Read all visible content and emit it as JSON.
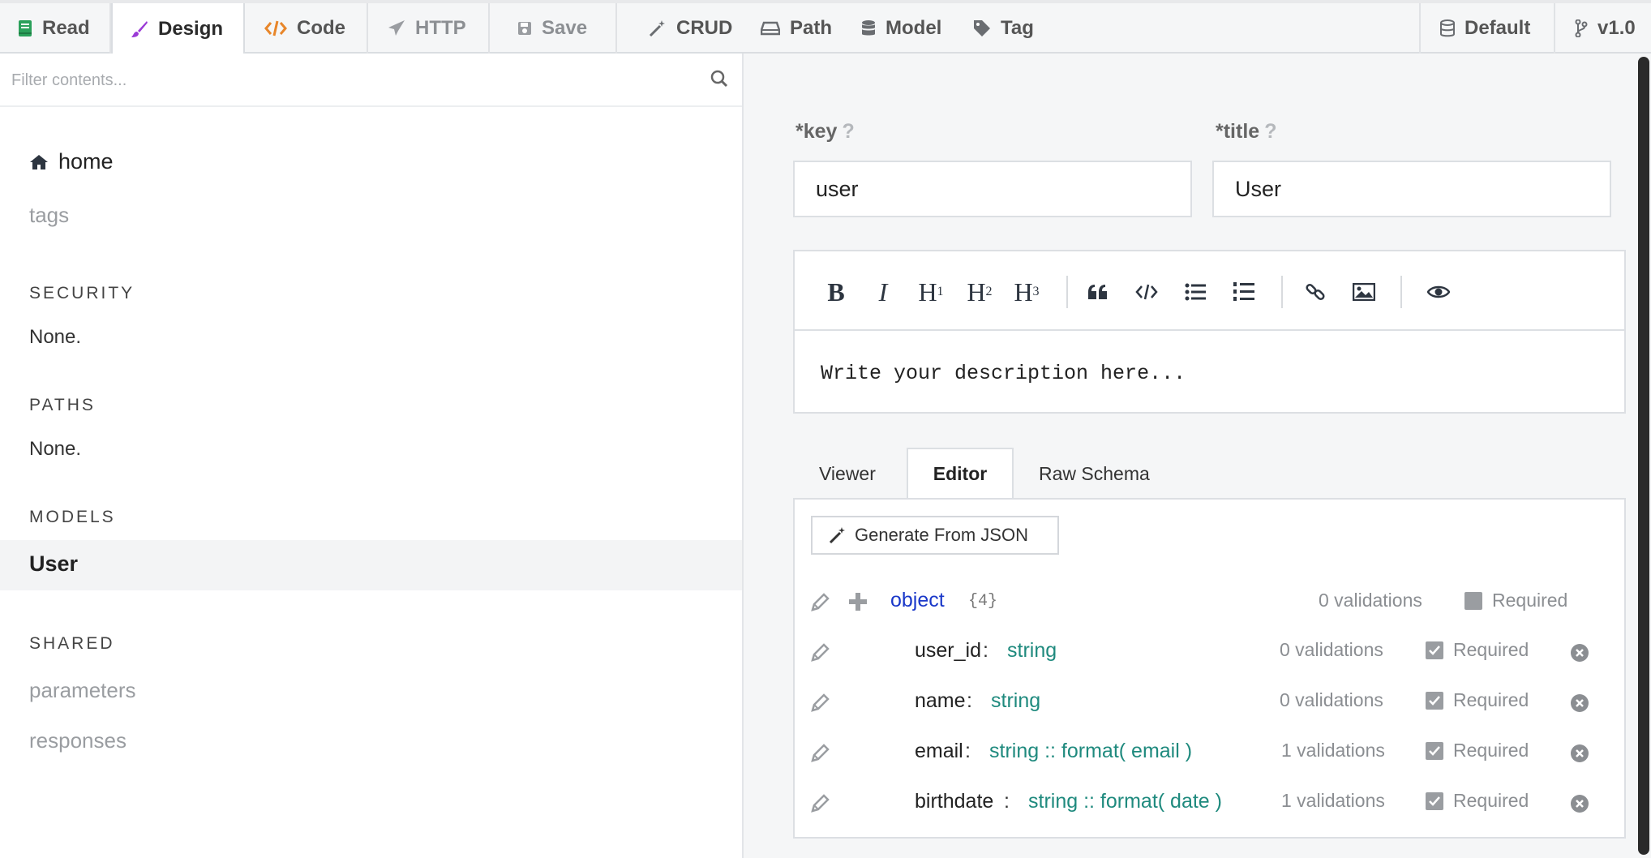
{
  "toolbar": {
    "tabs": [
      {
        "label": "Read",
        "icon": "book-icon",
        "color": "#2aa05a"
      },
      {
        "label": "Design",
        "icon": "paintbrush-icon",
        "color": "#9b3bd6"
      },
      {
        "label": "Code",
        "icon": "code-icon",
        "color": "#e8862a"
      },
      {
        "label": "HTTP",
        "icon": "paper-plane-icon"
      },
      {
        "label": "Save",
        "icon": "floppy-icon"
      },
      {
        "label": "CRUD",
        "icon": "magic-wand-icon"
      },
      {
        "label": "Path",
        "icon": "drive-icon"
      },
      {
        "label": "Model",
        "icon": "database-icon"
      },
      {
        "label": "Tag",
        "icon": "tag-icon"
      }
    ],
    "right": [
      {
        "label": "Default",
        "icon": "database-icon"
      },
      {
        "label": "v1.0",
        "icon": "branch-icon"
      }
    ]
  },
  "sidebar": {
    "filter_placeholder": "Filter contents...",
    "home": "home",
    "tags": "tags",
    "security_heading": "SECURITY",
    "security_value": "None.",
    "paths_heading": "PATHS",
    "paths_value": "None.",
    "models_heading": "MODELS",
    "selected_model": "User",
    "shared_heading": "SHARED",
    "shared_items": [
      "parameters",
      "responses"
    ]
  },
  "form": {
    "key_label": "*key",
    "key_help": "?",
    "key_value": "user",
    "title_label": "*title",
    "title_help": "?",
    "title_value": "User",
    "description_placeholder": "Write your description here...",
    "md_buttons": {
      "bold": "B",
      "italic": "I",
      "h1": "H",
      "h1_sub": "1",
      "h2": "H",
      "h2_sub": "2",
      "h3": "H",
      "h3_sub": "3"
    }
  },
  "schema_tabs": {
    "viewer": "Viewer",
    "editor": "Editor",
    "raw": "Raw Schema",
    "active": "Editor"
  },
  "schema": {
    "generate_button": "Generate From JSON",
    "root": {
      "type": "object",
      "count": "{4}",
      "validations": "0 validations",
      "required": "Required"
    },
    "properties": [
      {
        "name": "user_id",
        "colon": ":",
        "type": "string",
        "validations": "0 validations",
        "required": "Required"
      },
      {
        "name": "name",
        "colon": ":",
        "type": "string",
        "validations": "0 validations",
        "required": "Required"
      },
      {
        "name": "email",
        "colon": ":",
        "type": "string :: format( email )",
        "validations": "1 validations",
        "required": "Required"
      },
      {
        "name": "birthdate",
        "colon": ":",
        "type": "string :: format( date )",
        "validations": "1 validations",
        "required": "Required"
      }
    ]
  },
  "colors": {
    "accent_teal": "#1f8a7e",
    "object_blue": "#1a38c9",
    "muted": "#8b8e92"
  }
}
